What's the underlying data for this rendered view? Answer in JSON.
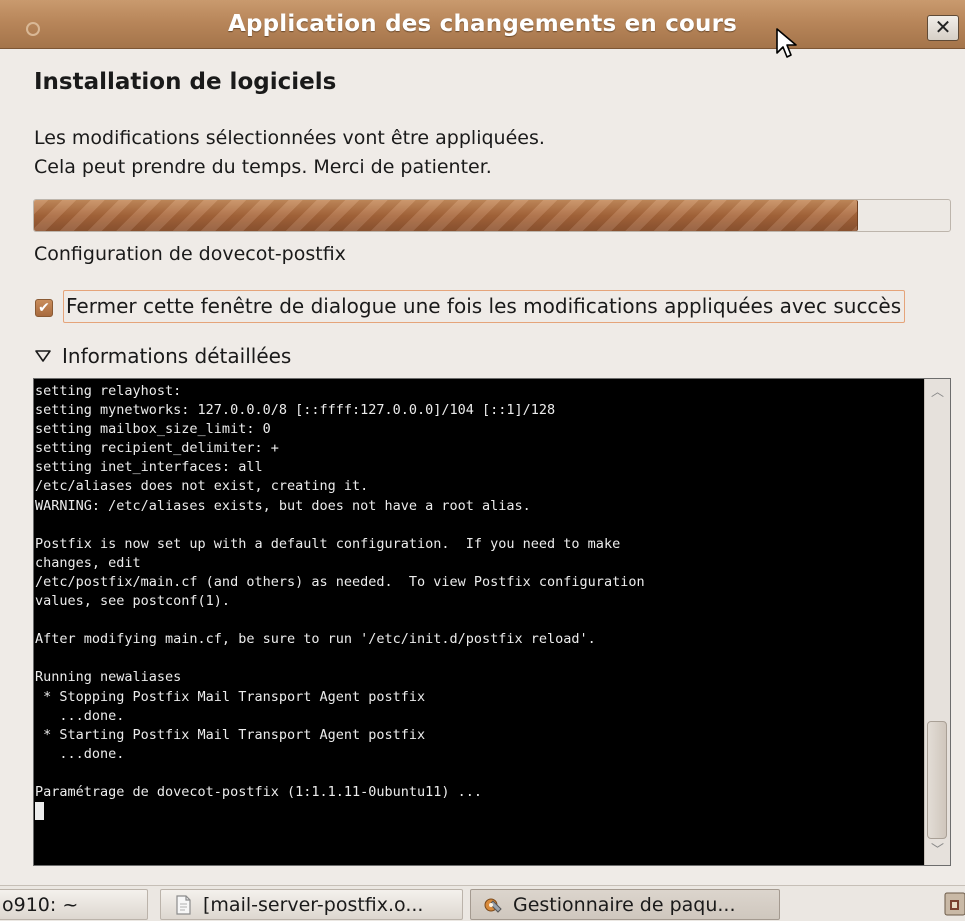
{
  "window": {
    "title": "Application des changements en cours",
    "close_glyph": "✕"
  },
  "dialog": {
    "heading": "Installation de logiciels",
    "description_line1": "Les modifications sélectionnées vont être appliquées.",
    "description_line2": "Cela peut prendre du temps. Merci de patienter.",
    "progress_fraction": 0.9,
    "status": "Configuration de dovecot-postfix",
    "close_checkbox": {
      "checked": true,
      "label": "Fermer cette fenêtre de dialogue une fois les modifications appliquées avec succès"
    },
    "details_expander": "Informations détaillées"
  },
  "terminal": {
    "lines": [
      "setting relayhost:",
      "setting mynetworks: 127.0.0.0/8 [::ffff:127.0.0.0]/104 [::1]/128",
      "setting mailbox_size_limit: 0",
      "setting recipient_delimiter: +",
      "setting inet_interfaces: all",
      "/etc/aliases does not exist, creating it.",
      "WARNING: /etc/aliases exists, but does not have a root alias.",
      "",
      "Postfix is now set up with a default configuration.  If you need to make",
      "changes, edit",
      "/etc/postfix/main.cf (and others) as needed.  To view Postfix configuration",
      "values, see postconf(1).",
      "",
      "After modifying main.cf, be sure to run '/etc/init.d/postfix reload'.",
      "",
      "Running newaliases",
      " * Stopping Postfix Mail Transport Agent postfix",
      "   ...done.",
      " * Starting Postfix Mail Transport Agent postfix",
      "   ...done.",
      "",
      "Paramétrage de dovecot-postfix (1:1.1.11-0ubuntu11) ..."
    ]
  },
  "taskbar": {
    "items": [
      {
        "label": "o910: ~"
      },
      {
        "label": "[mail-server-postfix.o..."
      },
      {
        "label": "Gestionnaire de paqu..."
      }
    ]
  },
  "colors": {
    "titlebar": "#b8865a",
    "accent": "#a8663b",
    "terminal_bg": "#000000",
    "terminal_fg": "#ececec"
  }
}
